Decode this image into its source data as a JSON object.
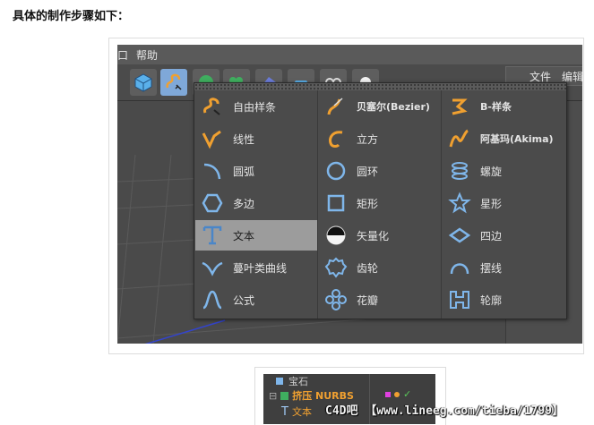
{
  "heading": "具体的制作步骤如下：",
  "menubar": {
    "left_fragment": "口",
    "help": "帮助"
  },
  "right_panel": {
    "file": "文件",
    "edit": "编辑"
  },
  "spline_menu": {
    "columns": [
      [
        {
          "label": "自由样条",
          "icon": "freehand-spline-icon"
        },
        {
          "label": "线性",
          "icon": "linear-spline-icon"
        },
        {
          "label": "圆弧",
          "icon": "arc-icon"
        },
        {
          "label": "多边",
          "icon": "polygon-icon"
        },
        {
          "label": "文本",
          "icon": "text-icon",
          "highlighted": true
        },
        {
          "label": "蔓叶类曲线",
          "icon": "cissoid-icon"
        },
        {
          "label": "公式",
          "icon": "formula-icon"
        }
      ],
      [
        {
          "label": "贝塞尔(Bezier)",
          "icon": "bezier-spline-icon"
        },
        {
          "label": "立方",
          "icon": "cubic-spline-icon"
        },
        {
          "label": "圆环",
          "icon": "circle-icon"
        },
        {
          "label": "矩形",
          "icon": "rectangle-icon"
        },
        {
          "label": "矢量化",
          "icon": "vectorizer-icon"
        },
        {
          "label": "齿轮",
          "icon": "cogwheel-icon"
        },
        {
          "label": "花瓣",
          "icon": "flower-icon"
        }
      ],
      [
        {
          "label": "B-样条",
          "icon": "b-spline-icon"
        },
        {
          "label": "阿基玛(Akima)",
          "icon": "akima-spline-icon"
        },
        {
          "label": "螺旋",
          "icon": "helix-icon"
        },
        {
          "label": "星形",
          "icon": "star-icon"
        },
        {
          "label": "四边",
          "icon": "4-side-icon"
        },
        {
          "label": "摆线",
          "icon": "cycloid-icon"
        },
        {
          "label": "轮廓",
          "icon": "profile-icon"
        }
      ]
    ]
  },
  "object_manager": {
    "row1": "宝石",
    "row2": "挤压 NURBS",
    "row3": "文本"
  },
  "watermark": "C4D吧 【www.lineeg.com/tieba/1799】",
  "colors": {
    "icon_orange": "#f0a030",
    "icon_blue": "#7fb6ea",
    "highlight": "#9c9c9c",
    "menu_bg": "#4b4b4b"
  }
}
